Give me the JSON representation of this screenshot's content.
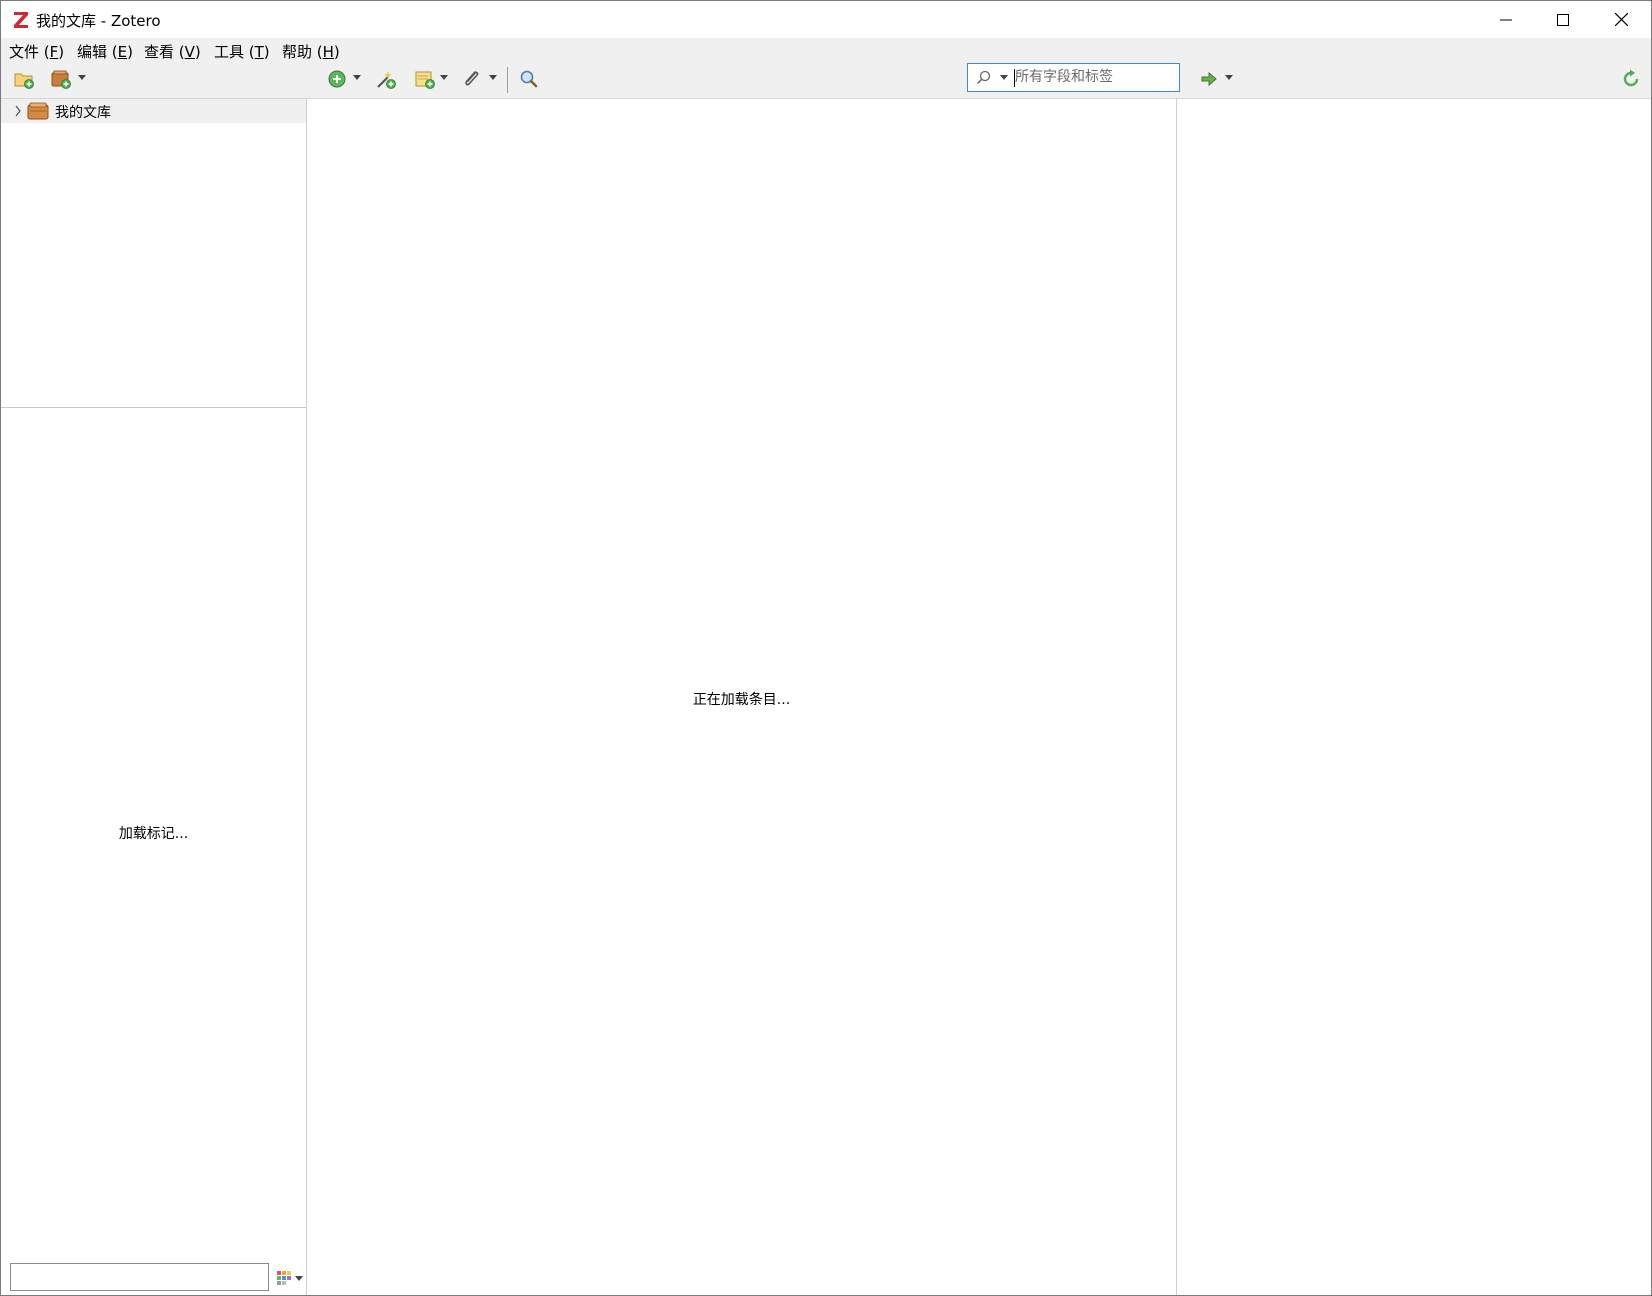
{
  "window": {
    "title": "我的文库 - Zotero"
  },
  "menubar": {
    "items": [
      {
        "label": "文件 (",
        "key": "F",
        "suffix": ")"
      },
      {
        "label": "编辑 (",
        "key": "E",
        "suffix": ")"
      },
      {
        "label": "查看 (",
        "key": "V",
        "suffix": ")"
      },
      {
        "label": "工具 (",
        "key": "T",
        "suffix": ")"
      },
      {
        "label": "帮助 (",
        "key": "H",
        "suffix": ")"
      }
    ]
  },
  "toolbar": {
    "search_placeholder": "所有字段和标签",
    "search_value": ""
  },
  "collections": {
    "items": [
      {
        "label": "我的文库"
      }
    ]
  },
  "tag_selector": {
    "loading_text": "加载标记...",
    "filter_value": ""
  },
  "items_pane": {
    "loading_text": "正在加载条目..."
  },
  "colors": {
    "accent_border": "#3b8bd1",
    "toolbar_bg": "#f0f0f0",
    "zotero_red": "#cc2936",
    "green_add": "#4caf50"
  },
  "icons": {
    "app": "zotero-z-icon",
    "new_collection": "new-collection-icon",
    "new_library": "new-library-icon",
    "new_item": "new-item-icon",
    "add_by_identifier": "add-by-identifier-icon",
    "new_note": "new-note-icon",
    "attachment": "paperclip-icon",
    "advanced_search": "magnifier-icon",
    "search_mode": "search-icon",
    "locate": "locate-arrow-icon",
    "sync": "sync-icon"
  }
}
